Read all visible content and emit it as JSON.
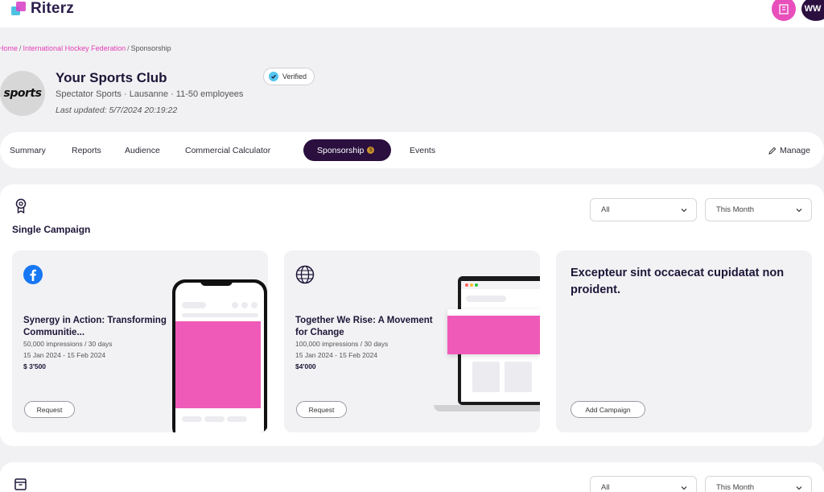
{
  "app": {
    "name": "Riterz",
    "user_initials": "WW"
  },
  "breadcrumb": {
    "items": [
      "Home",
      "International Hockey Federation",
      "Sponsorship"
    ]
  },
  "club": {
    "logo_text": "sports",
    "name": "Your Sports Club",
    "meta": "Spectator Sports · Lausanne · 11-50 employees",
    "last_updated": "Last updated: 5/7/2024 20:19:22",
    "verified_label": "Verified"
  },
  "tabs": [
    {
      "label": "Summary"
    },
    {
      "label": "Reports"
    },
    {
      "label": "Audience"
    },
    {
      "label": "Commercial Calculator"
    },
    {
      "label": "Sponsorship",
      "active": true
    },
    {
      "label": "Events"
    }
  ],
  "manage_label": "Manage",
  "section": {
    "title": "Single Campaign",
    "filter_type": "All",
    "filter_period": "This Month"
  },
  "cards": [
    {
      "platform_icon": "facebook-icon",
      "title": "Synergy in Action: Transforming Communitie...",
      "impressions": "50,000 impressions /  30 days",
      "dates": "15 Jan 2024 - 15 Feb 2024",
      "price": "$ 3'500",
      "button": "Request"
    },
    {
      "platform_icon": "globe-icon",
      "title": "Together We Rise: A Movement for Change",
      "impressions": "100,000 impressions / 30 days",
      "dates": "15 Jan 2024 - 15 Feb 2024",
      "price": "$4'000",
      "button": "Request"
    }
  ],
  "add_card": {
    "text": "Excepteur sint occaecat cupidatat non proident.",
    "button": "Add Campaign"
  },
  "section2": {
    "filter_type": "All",
    "filter_period": "This Month"
  },
  "colors": {
    "accent_pink": "#ef5ab9",
    "brand_dark": "#2a0f3f",
    "verified_blue": "#53c6f0"
  }
}
